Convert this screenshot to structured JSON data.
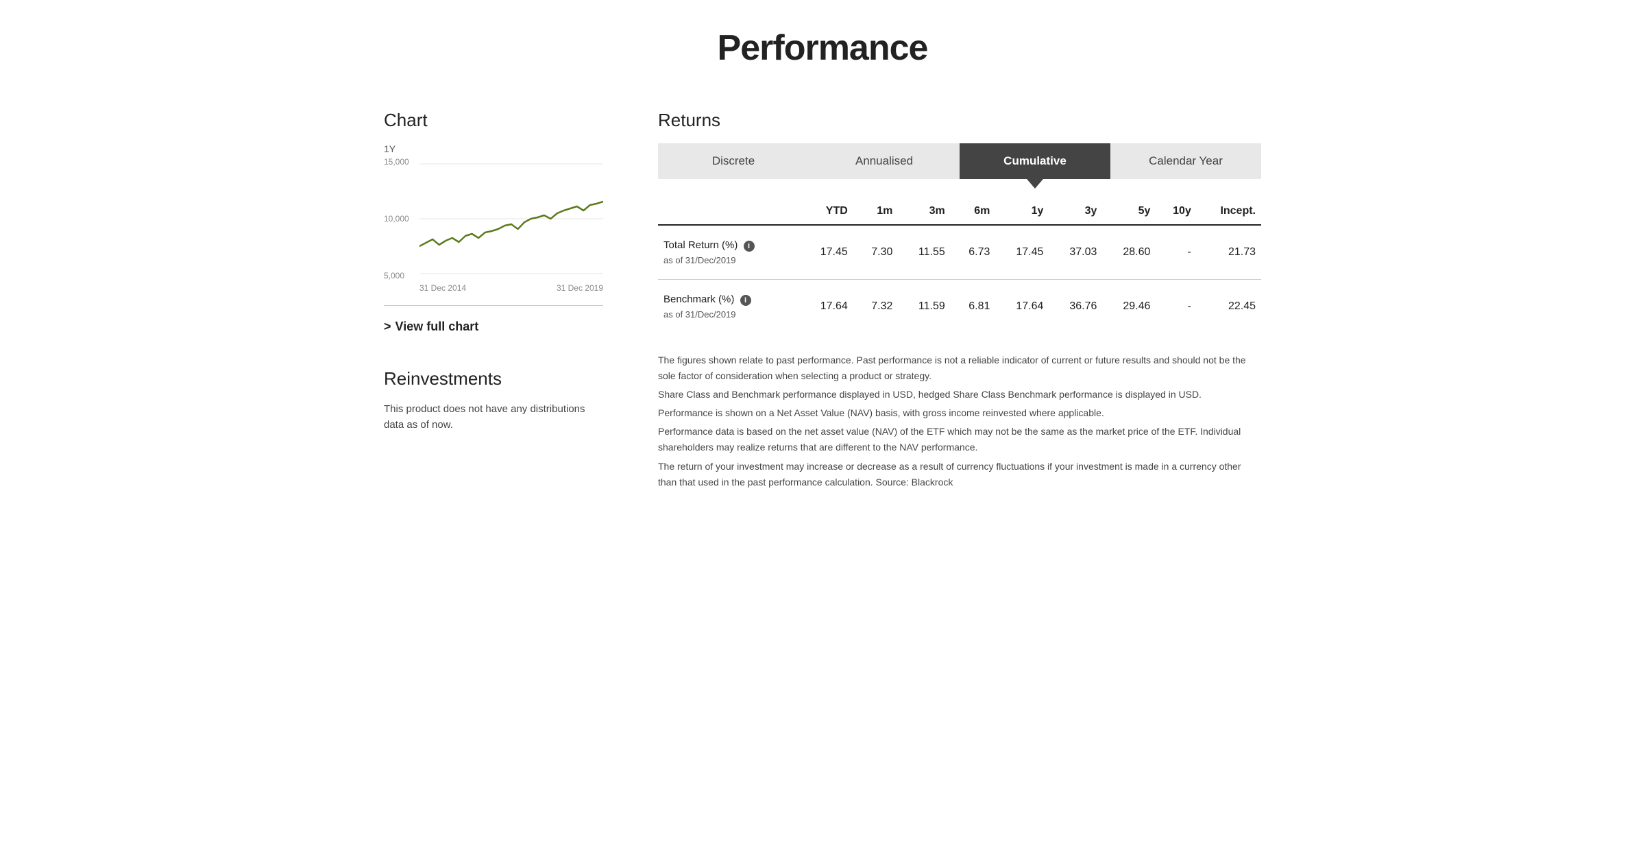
{
  "page": {
    "title": "Performance"
  },
  "left": {
    "chart_heading": "Chart",
    "chart_period_label": "1Y",
    "chart_x_start": "31 Dec 2014",
    "chart_x_end": "31 Dec 2019",
    "chart_y_labels": [
      "15,000",
      "10,000",
      "5,000"
    ],
    "view_full_chart_label": "View full chart",
    "reinvestments_heading": "Reinvestments",
    "reinvestments_text": "This product does not have any distributions data as of now."
  },
  "returns": {
    "heading": "Returns",
    "tabs": [
      {
        "id": "discrete",
        "label": "Discrete",
        "active": false
      },
      {
        "id": "annualised",
        "label": "Annualised",
        "active": false
      },
      {
        "id": "cumulative",
        "label": "Cumulative",
        "active": true
      },
      {
        "id": "calendar-year",
        "label": "Calendar Year",
        "active": false
      }
    ],
    "columns": [
      "",
      "YTD",
      "1m",
      "3m",
      "6m",
      "1y",
      "3y",
      "5y",
      "10y",
      "Incept."
    ],
    "rows": [
      {
        "label": "Total Return (%)",
        "sub_label": "as of 31/Dec/2019",
        "has_info": true,
        "values": [
          "17.45",
          "7.30",
          "11.55",
          "6.73",
          "17.45",
          "37.03",
          "28.60",
          "-",
          "21.73"
        ]
      },
      {
        "label": "Benchmark (%)",
        "sub_label": "as of 31/Dec/2019",
        "has_info": true,
        "values": [
          "17.64",
          "7.32",
          "11.59",
          "6.81",
          "17.64",
          "36.76",
          "29.46",
          "-",
          "22.45"
        ]
      }
    ],
    "disclaimer_lines": [
      "The figures shown relate to past performance. Past performance is not a reliable indicator of current or future results and should not be the sole factor of consideration when selecting a product or strategy.",
      "Share Class and Benchmark performance displayed in USD, hedged Share Class Benchmark performance is displayed in USD.",
      "Performance is shown on a Net Asset Value (NAV) basis, with gross income reinvested where applicable.",
      "Performance data is based on the net asset value (NAV) of the ETF which may not be the same as the market price of the ETF. Individual shareholders may realize returns that are different to the NAV performance.",
      "The return of your investment may increase or decrease as a result of currency fluctuations if your investment is made in a currency other than that used in the past performance calculation. Source: Blackrock"
    ]
  },
  "icons": {
    "info": "i",
    "chevron_right": ">"
  }
}
